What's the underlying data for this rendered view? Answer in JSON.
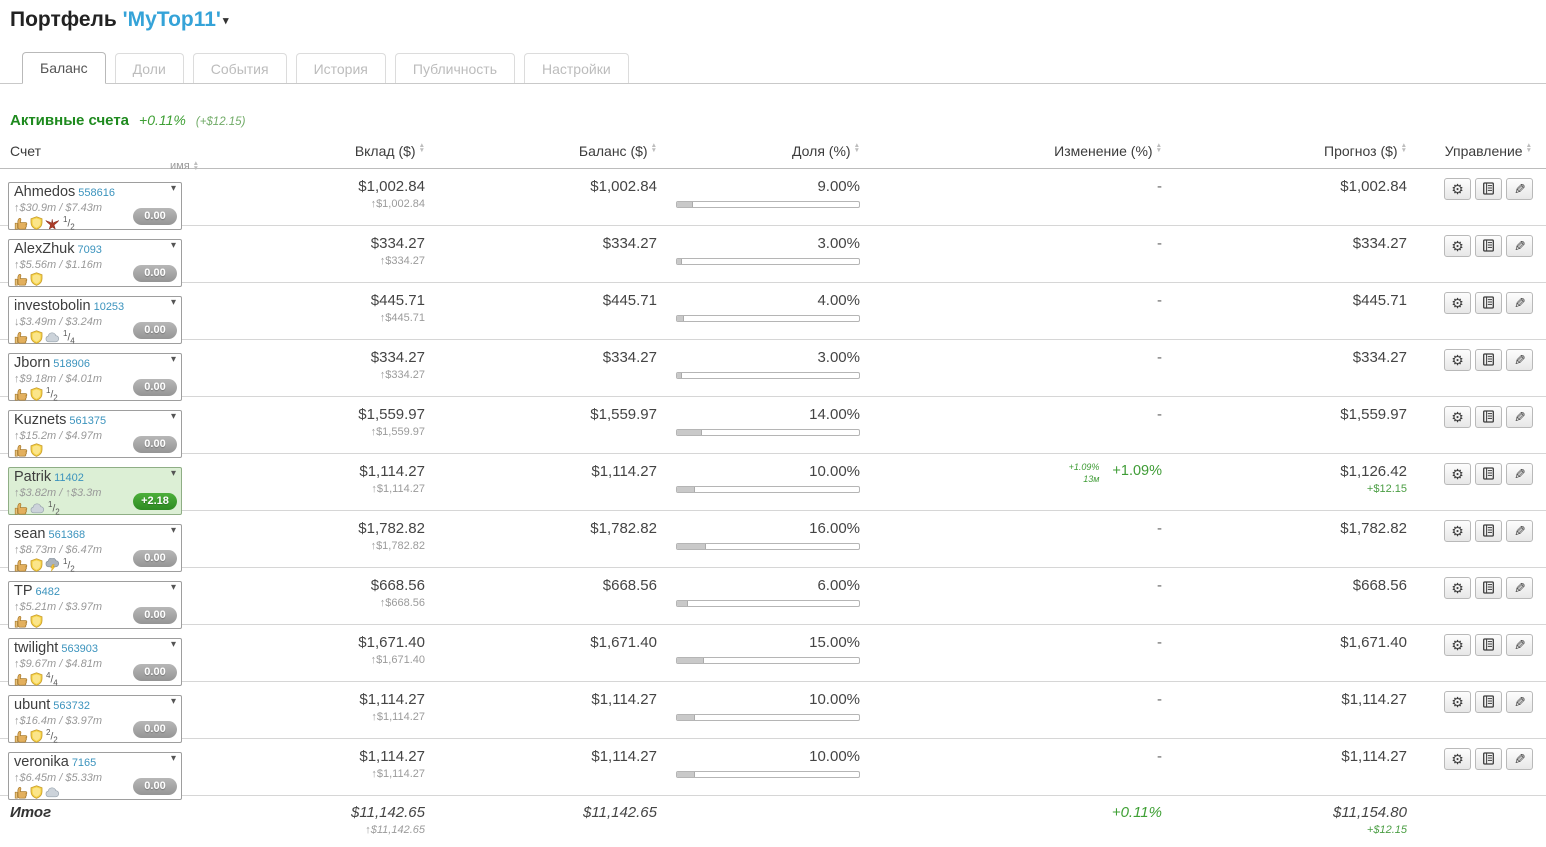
{
  "page": {
    "title_prefix": "Портфель",
    "portfolio_name": "'MyTop11'"
  },
  "tabs": [
    {
      "label": "Баланс",
      "active": true
    },
    {
      "label": "Доли",
      "active": false
    },
    {
      "label": "События",
      "active": false
    },
    {
      "label": "История",
      "active": false
    },
    {
      "label": "Публичность",
      "active": false
    },
    {
      "label": "Настройки",
      "active": false
    }
  ],
  "section": {
    "title": "Активные счета",
    "change_pct": "+0.11%",
    "change_abs": "(+$12.15)"
  },
  "table_headers": {
    "account": "Счет",
    "name": "имя",
    "deposit": "Вклад ($)",
    "balance": "Баланс ($)",
    "share": "Доля (%)",
    "change": "Изменение (%)",
    "forecast": "Прогноз ($)",
    "manage": "Управление"
  },
  "manage_icons": [
    "settings",
    "log",
    "edit"
  ],
  "accounts": [
    {
      "name": "Ahmedos",
      "id": "558616",
      "stats": "↑$30.9m / $7.43m",
      "icons": [
        "thumbs-up",
        "shield",
        "eagle"
      ],
      "fraction": "1/2",
      "badge": "0.00",
      "badge_positive": false,
      "highlight": false,
      "deposit": "$1,002.84",
      "deposit_sub": "↑$1,002.84",
      "balance": "$1,002.84",
      "share_pct": "9.00%",
      "share_value": 9,
      "change_main": "-",
      "forecast": "$1,002.84"
    },
    {
      "name": "AlexZhuk",
      "id": "7093",
      "stats": "↑$5.56m / $1.16m",
      "icons": [
        "thumbs-up",
        "shield"
      ],
      "fraction": "",
      "badge": "0.00",
      "badge_positive": false,
      "highlight": false,
      "deposit": "$334.27",
      "deposit_sub": "↑$334.27",
      "balance": "$334.27",
      "share_pct": "3.00%",
      "share_value": 3,
      "change_main": "-",
      "forecast": "$334.27"
    },
    {
      "name": "investobolin",
      "id": "10253",
      "stats": "↓$3.49m / $3.24m",
      "icons": [
        "thumbs-up",
        "shield",
        "cloud"
      ],
      "fraction": "1/4",
      "badge": "0.00",
      "badge_positive": false,
      "highlight": false,
      "deposit": "$445.71",
      "deposit_sub": "↑$445.71",
      "balance": "$445.71",
      "share_pct": "4.00%",
      "share_value": 4,
      "change_main": "-",
      "forecast": "$445.71"
    },
    {
      "name": "Jborn",
      "id": "518906",
      "stats": "↑$9.18m / $4.01m",
      "icons": [
        "thumbs-up",
        "shield"
      ],
      "fraction": "1/2",
      "badge": "0.00",
      "badge_positive": false,
      "highlight": false,
      "deposit": "$334.27",
      "deposit_sub": "↑$334.27",
      "balance": "$334.27",
      "share_pct": "3.00%",
      "share_value": 3,
      "change_main": "-",
      "forecast": "$334.27"
    },
    {
      "name": "Kuznets",
      "id": "561375",
      "stats": "↑$15.2m / $4.97m",
      "icons": [
        "thumbs-up",
        "shield"
      ],
      "fraction": "",
      "badge": "0.00",
      "badge_positive": false,
      "highlight": false,
      "deposit": "$1,559.97",
      "deposit_sub": "↑$1,559.97",
      "balance": "$1,559.97",
      "share_pct": "14.00%",
      "share_value": 14,
      "change_main": "-",
      "forecast": "$1,559.97"
    },
    {
      "name": "Patrik",
      "id": "11402",
      "stats": "↑$3.82m / ↑$3.3m",
      "icons": [
        "thumbs-up",
        "cloud"
      ],
      "fraction": "1/2",
      "badge": "+2.18",
      "badge_positive": true,
      "highlight": true,
      "deposit": "$1,114.27",
      "deposit_sub": "↑$1,114.27",
      "balance": "$1,114.27",
      "share_pct": "10.00%",
      "share_value": 10,
      "change_main": "+1.09%",
      "change_mini_pct": "+1.09%",
      "change_mini_period": "13м",
      "forecast": "$1,126.42",
      "forecast_sub": "+$12.15"
    },
    {
      "name": "sean",
      "id": "561368",
      "stats": "↑$8.73m / $6.47m",
      "icons": [
        "thumbs-up",
        "shield",
        "storm"
      ],
      "fraction": "1/2",
      "badge": "0.00",
      "badge_positive": false,
      "highlight": false,
      "deposit": "$1,782.82",
      "deposit_sub": "↑$1,782.82",
      "balance": "$1,782.82",
      "share_pct": "16.00%",
      "share_value": 16,
      "change_main": "-",
      "forecast": "$1,782.82"
    },
    {
      "name": "TP",
      "id": "6482",
      "stats": "↑$5.21m / $3.97m",
      "icons": [
        "thumbs-up",
        "shield"
      ],
      "fraction": "",
      "badge": "0.00",
      "badge_positive": false,
      "highlight": false,
      "deposit": "$668.56",
      "deposit_sub": "↑$668.56",
      "balance": "$668.56",
      "share_pct": "6.00%",
      "share_value": 6,
      "change_main": "-",
      "forecast": "$668.56"
    },
    {
      "name": "twilight",
      "id": "563903",
      "stats": "↑$9.67m / $4.81m",
      "icons": [
        "thumbs-up",
        "shield"
      ],
      "fraction": "4/4",
      "badge": "0.00",
      "badge_positive": false,
      "highlight": false,
      "deposit": "$1,671.40",
      "deposit_sub": "↑$1,671.40",
      "balance": "$1,671.40",
      "share_pct": "15.00%",
      "share_value": 15,
      "change_main": "-",
      "forecast": "$1,671.40"
    },
    {
      "name": "ubunt",
      "id": "563732",
      "stats": "↑$16.4m / $3.97m",
      "icons": [
        "thumbs-up",
        "shield"
      ],
      "fraction": "2/2",
      "badge": "0.00",
      "badge_positive": false,
      "highlight": false,
      "deposit": "$1,114.27",
      "deposit_sub": "↑$1,114.27",
      "balance": "$1,114.27",
      "share_pct": "10.00%",
      "share_value": 10,
      "change_main": "-",
      "forecast": "$1,114.27"
    },
    {
      "name": "veronika",
      "id": "7165",
      "stats": "↑$6.45m / $5.33m",
      "icons": [
        "thumbs-up",
        "shield",
        "cloud"
      ],
      "fraction": "",
      "badge": "0.00",
      "badge_positive": false,
      "highlight": false,
      "deposit": "$1,114.27",
      "deposit_sub": "↑$1,114.27",
      "balance": "$1,114.27",
      "share_pct": "10.00%",
      "share_value": 10,
      "change_main": "-",
      "forecast": "$1,114.27"
    }
  ],
  "totals": {
    "label": "Итог",
    "deposit": "$11,142.65",
    "deposit_sub": "↑$11,142.65",
    "balance": "$11,142.65",
    "change": "+0.11%",
    "forecast": "$11,154.80",
    "forecast_sub": "+$12.15"
  },
  "colors": {
    "accent_green": "#1e8a1e",
    "positive_green": "#3f9c36",
    "link_blue": "#35a3d8",
    "id_blue": "#3b93bd",
    "badge_gray": "#9e9e9e"
  }
}
